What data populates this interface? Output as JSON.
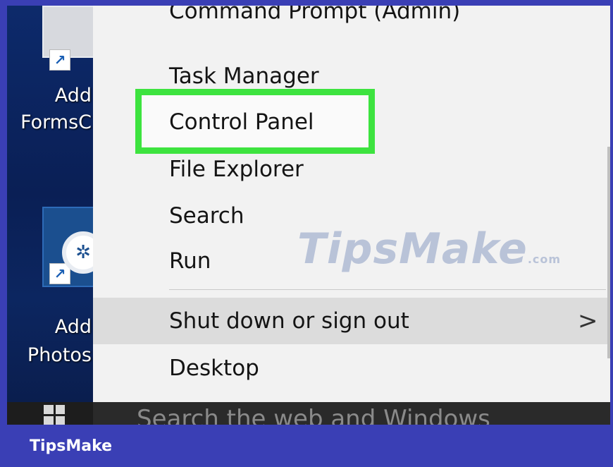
{
  "desktop": {
    "icons": [
      {
        "label_line1": "Add",
        "label_line2": "FormsC",
        "icon": "document-shortcut-icon"
      },
      {
        "label_line1": "Add",
        "label_line2": "Photos",
        "icon": "camera-lens-shortcut-icon"
      }
    ]
  },
  "menu": {
    "items": [
      {
        "label": "Command Prompt (Admin)"
      },
      {
        "label": "Task Manager"
      },
      {
        "label": "Control Panel",
        "highlighted": true
      },
      {
        "label": "File Explorer"
      },
      {
        "label": "Search"
      },
      {
        "label": "Run"
      },
      {
        "label": "Shut down or sign out",
        "has_submenu": true
      },
      {
        "label": "Desktop"
      }
    ],
    "submenu_arrow": ">",
    "highlight_color": "#3de33f"
  },
  "taskbar": {
    "search_placeholder": "Search the web and Windows"
  },
  "watermark": {
    "text": "TipsMake",
    "suffix": ".com"
  },
  "brand": {
    "text": "TipsMake",
    "background": "#3a3fb5"
  }
}
